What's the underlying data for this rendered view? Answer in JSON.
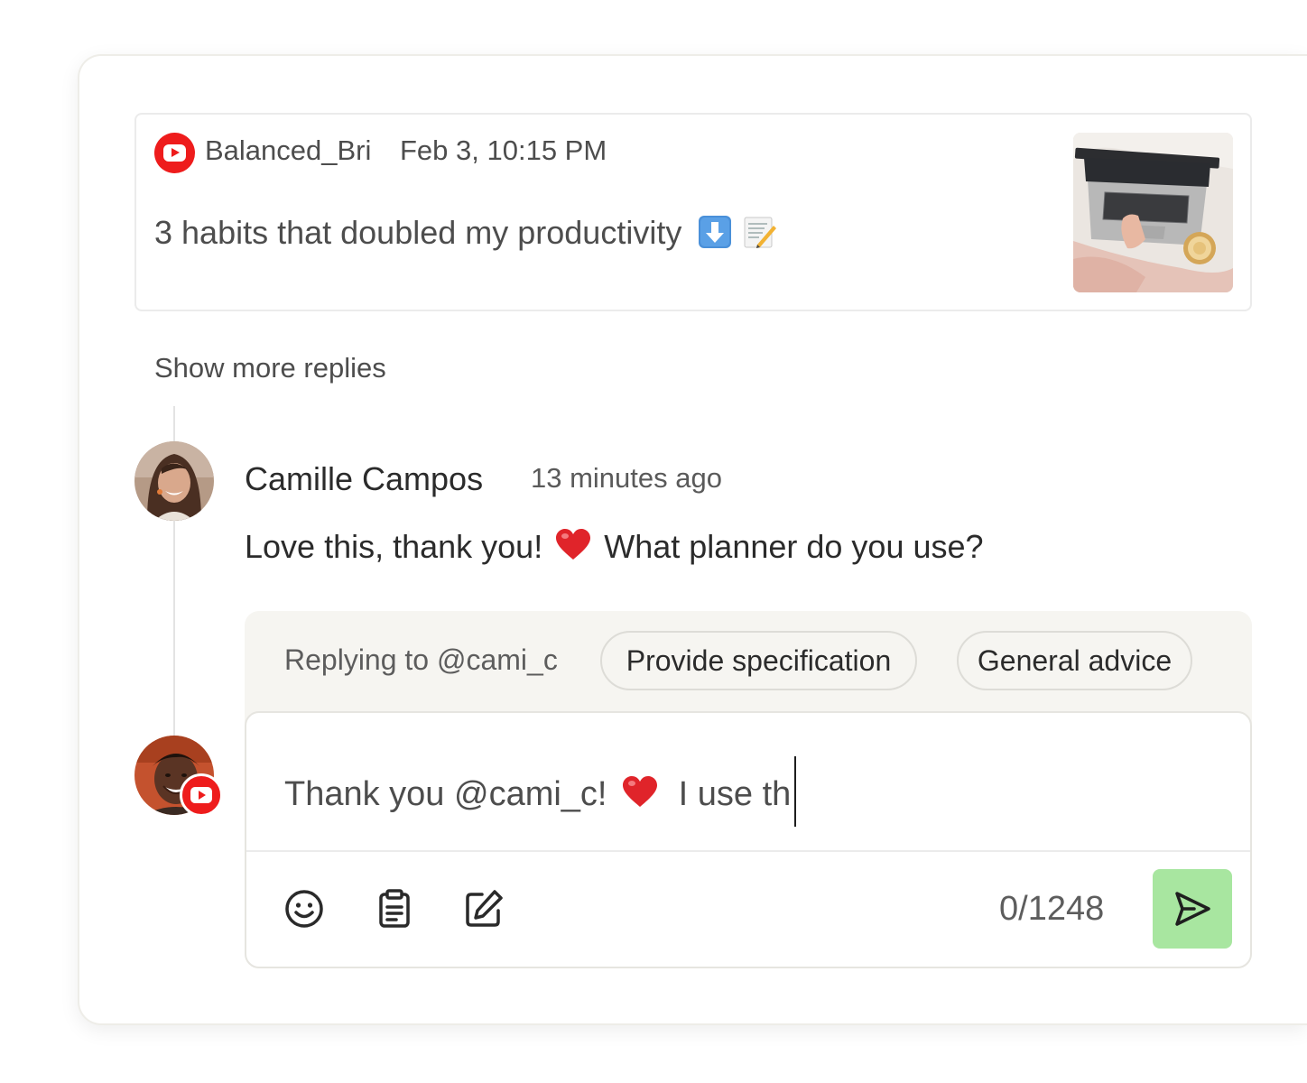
{
  "post": {
    "platform_icon": "youtube-icon",
    "author": "Balanced_Bri",
    "date": "Feb 3, 10:15 PM",
    "text": "3 habits that doubled my productivity",
    "emojis": [
      "down-arrow-emoji",
      "memo-emoji"
    ]
  },
  "thread": {
    "show_more_label": "Show more replies"
  },
  "comment": {
    "author": "Camille Campos",
    "time": "13 minutes ago",
    "text_before": "Love this, thank you!",
    "text_after": "What planner do you use?",
    "emoji": "red-heart-emoji"
  },
  "reply": {
    "replying_to": "Replying to @cami_c",
    "suggestions": [
      "Provide specification",
      "General advice"
    ],
    "input_before": "Thank you @cami_c!",
    "input_after": "I use th",
    "char_count": "0/1248"
  },
  "colors": {
    "youtube_red": "#ee1c1c",
    "send_button": "#a8e6a0",
    "panel_bg": "#f6f5f1"
  }
}
